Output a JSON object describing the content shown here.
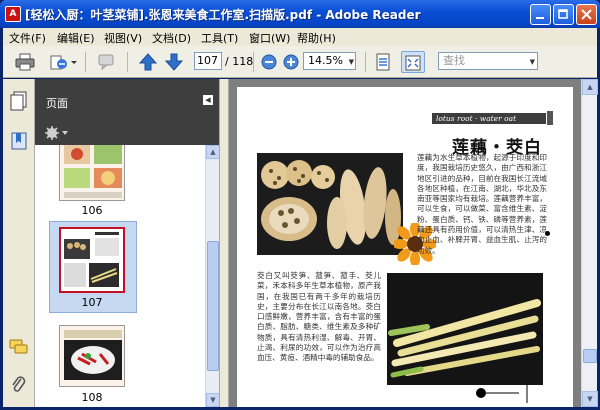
{
  "window": {
    "title": "[轻松入厨：叶茎菜铺].张恩来美食工作室.扫描版.pdf - Adobe Reader",
    "app_icon_text": "A"
  },
  "menu": [
    "文件(F)",
    "编辑(E)",
    "视图(V)",
    "文档(D)",
    "工具(T)",
    "窗口(W)",
    "帮助(H)"
  ],
  "toolbar": {
    "page_current": "107",
    "page_total": "/ 118",
    "zoom": "14.5%",
    "search_placeholder": "查找"
  },
  "nav": {
    "title": "页面",
    "thumbnails": [
      {
        "label": "106"
      },
      {
        "label": "107",
        "selected": true
      },
      {
        "label": "108"
      }
    ]
  },
  "document": {
    "header": "lotus root · water oat",
    "title": "莲藕・茭白",
    "para_right": "莲藕为水生草本植物，起源于印度和印度，我国栽培历史悠久，由广西和浙江地区引进的品种，目前在我国长江流域各地区种植，在江南、湖北，华北及东南亚等国家均有栽培。莲藕营养丰富，可以生食，可以做菜、富含维生素、淀粉、蛋白质、钙、铁、磷等营养素，莲藕还具有药用价值，可以清热生津、凉血止血、补脾开胃、益血生肌、止泻的功效。",
    "para_left": "茭白又叫茭笋、菰笋、菰手、茭儿菜，禾本科多年生草本植物，原产我国，在我国已有两千多年的栽培历史，主要分布在长江以南各地。茭白口感鲜嫩，营养丰富，含有丰富的蛋白质、脂肪、糖类、维生素及多种矿物质，具有清热利湿、解毒、开胃、止渴、利尿的功效，可以作为治疗高血压、黄疸、酒精中毒的辅助食品。"
  },
  "colors": {
    "title_bar": "#0a4fd6",
    "nav_header": "#3e3e3e",
    "doc_background": "#7f7f7f"
  }
}
